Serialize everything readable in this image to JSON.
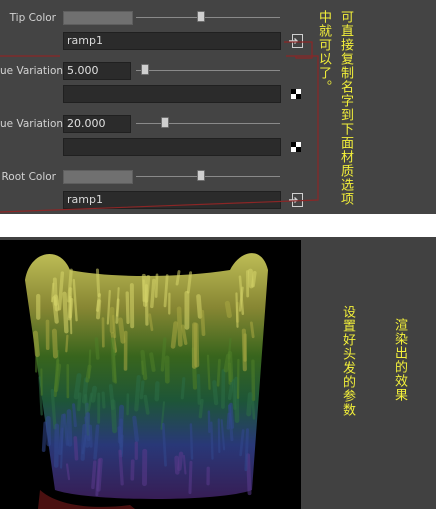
{
  "attributes": {
    "tip_color": {
      "label": "Tip Color",
      "slider": 0.45,
      "map": "ramp1",
      "color": "#707070"
    },
    "hue_variation": {
      "label": "ue Variation",
      "value": "5.000",
      "slider": 0.06,
      "map": ""
    },
    "value_variation": {
      "label": "ue Variation",
      "value": "20.000",
      "slider": 0.2,
      "map": ""
    },
    "root_color": {
      "label": "Root Color",
      "slider": 0.45,
      "map": "ramp1",
      "color": "#707070"
    }
  },
  "annotations": {
    "copy_name_note_col1": "可直接复制名字到下面材质选项",
    "copy_name_note_col2": "中就可以了。",
    "set_hair_params_note": "设置好头发的参数",
    "render_result_note": "渲染出的效果"
  },
  "colors": {
    "panel_bg": "#444444",
    "annotation_text": "#f2ef3a",
    "bracket_line": "#8b2626",
    "hair_top": "#b6b547",
    "hair_mid": "#2f6a1c",
    "hair_bottom": "#3a2a7a"
  },
  "icons": {
    "connect": "input-connection-icon",
    "checker": "checker-map-icon"
  }
}
